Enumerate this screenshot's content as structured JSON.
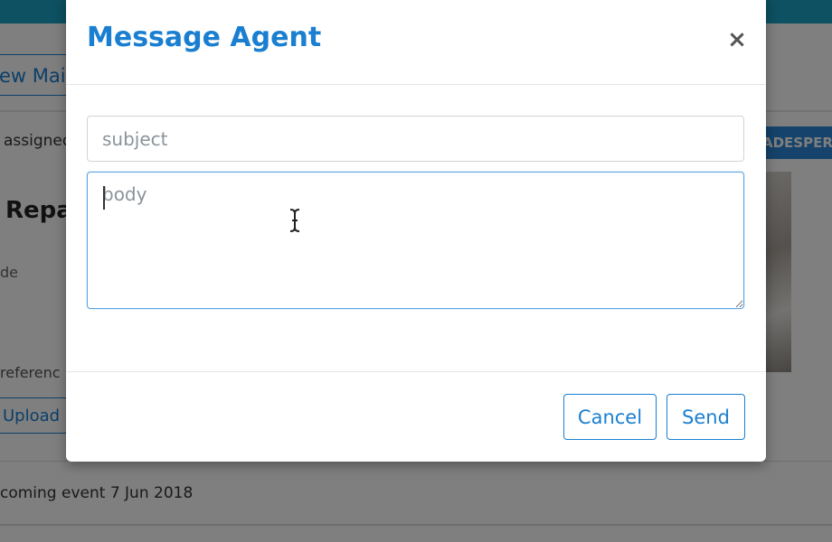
{
  "background": {
    "main_button_label": "ew Mai",
    "assigned_text": "assigned",
    "badge_text": "ADESPERS",
    "title_text": "Repa",
    "small_text": "de",
    "reference_text": "referenc",
    "upload_label": "Upload",
    "upcoming_text": "coming event 7 Jun 2018"
  },
  "modal": {
    "title": "Message Agent",
    "close_label": "×",
    "subject": {
      "value": "",
      "placeholder": "subject"
    },
    "body": {
      "value": "",
      "placeholder": "body"
    },
    "cancel_label": "Cancel",
    "send_label": "Send"
  },
  "colors": {
    "accent": "#1a7fd0",
    "topbar": "#1aa3c4",
    "badge": "#2b86d6"
  }
}
